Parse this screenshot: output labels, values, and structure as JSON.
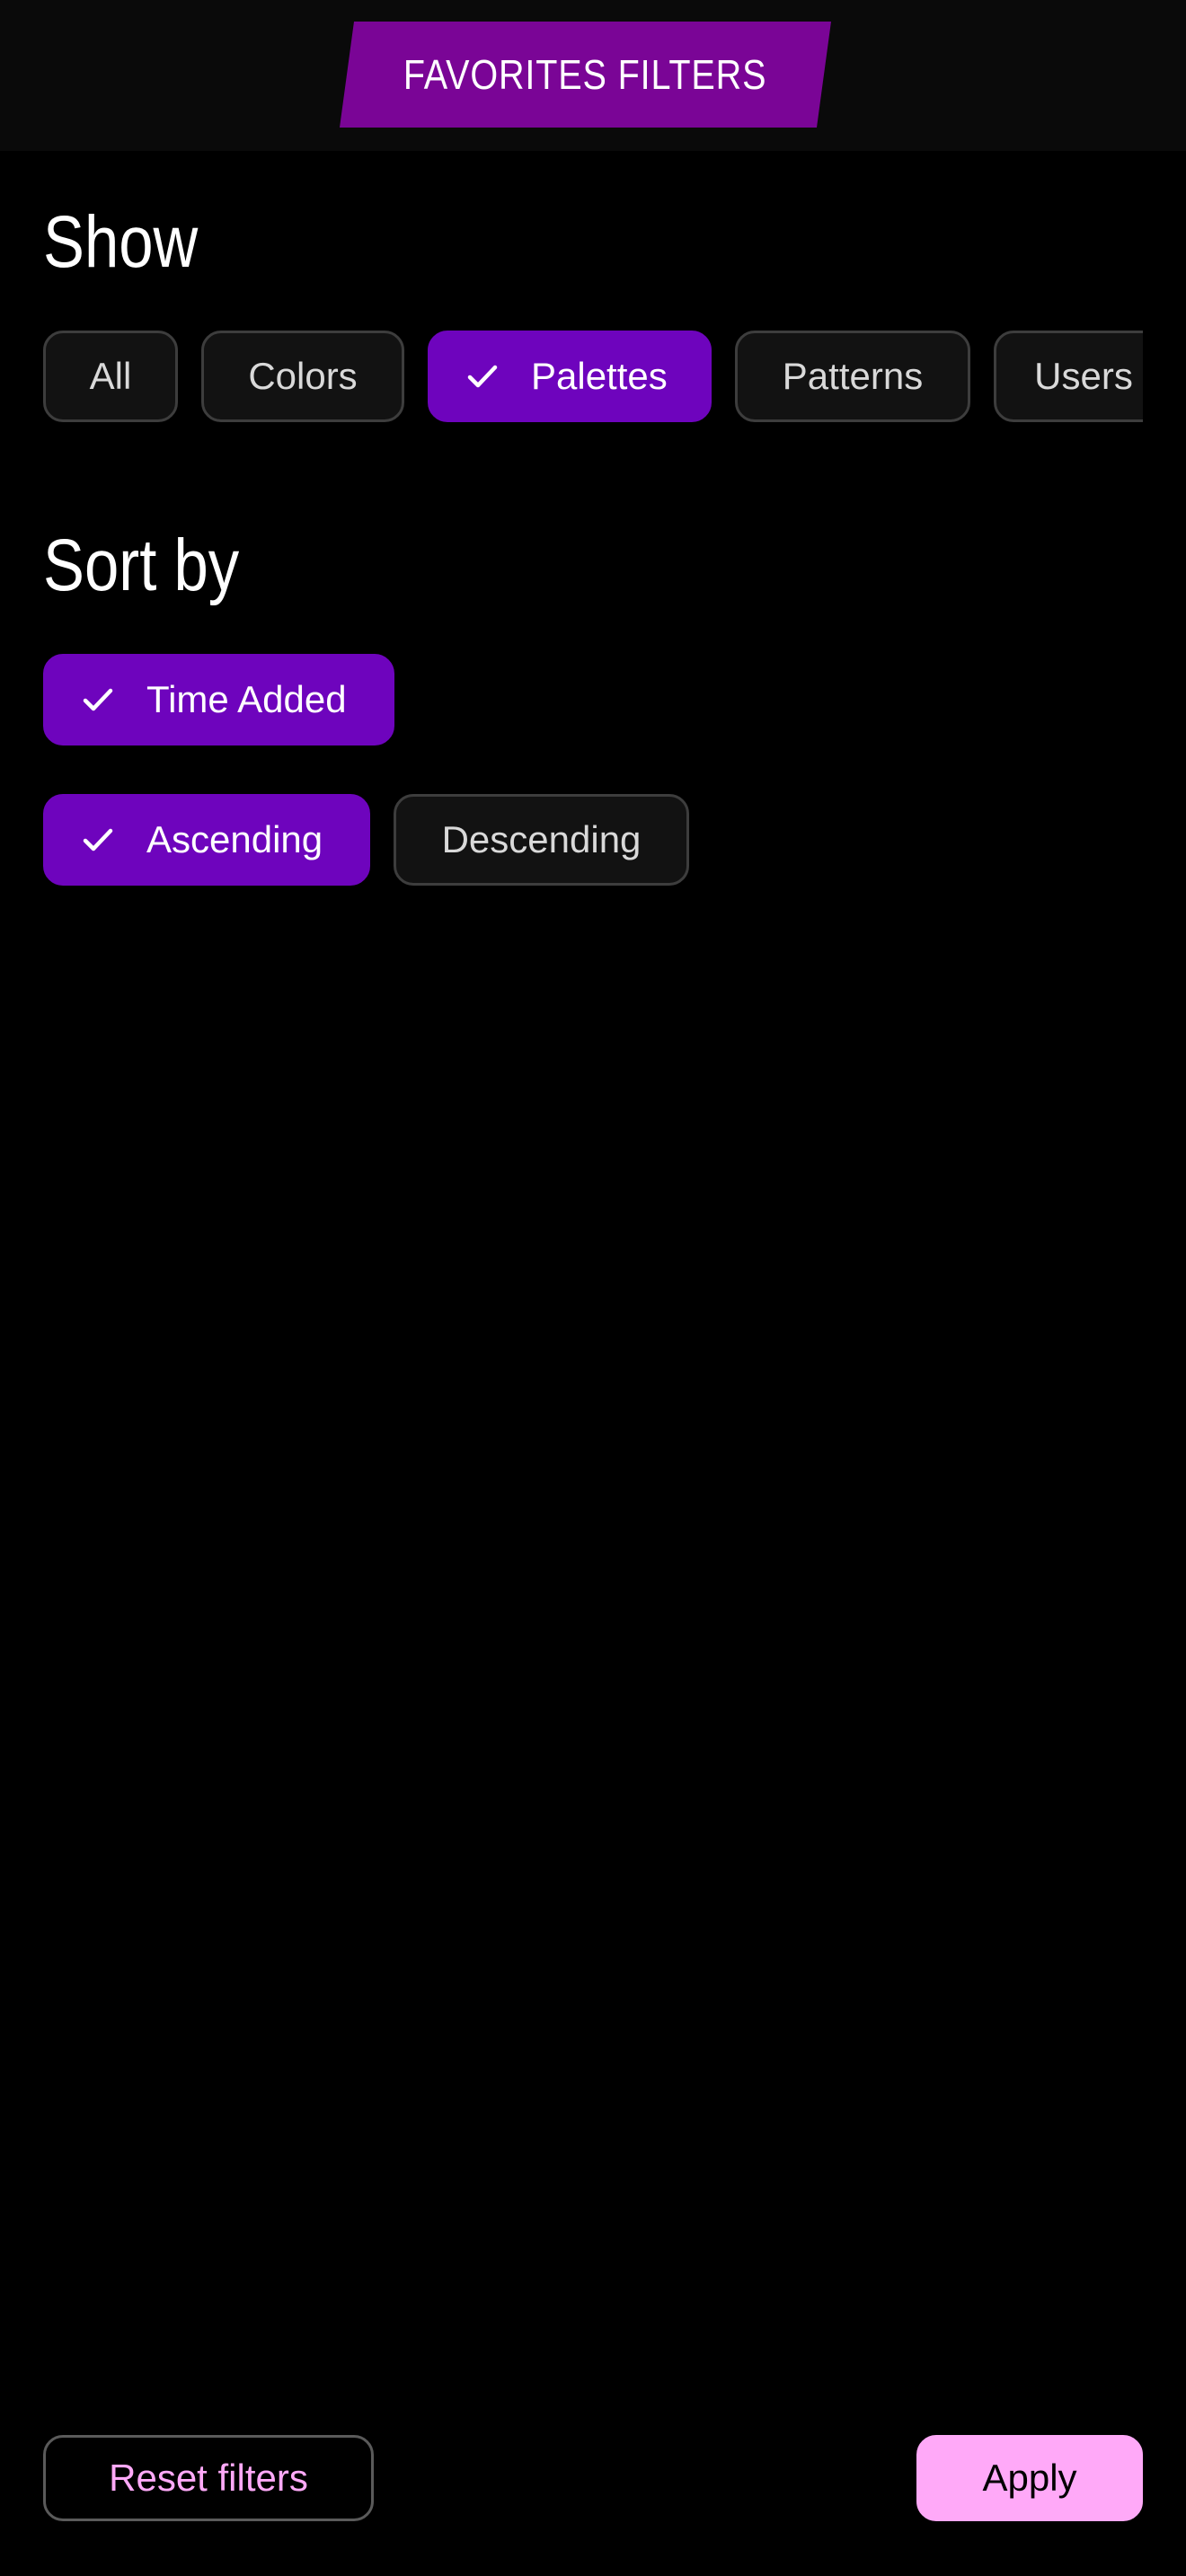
{
  "header": {
    "title": "FAVORITES FILTERS"
  },
  "show": {
    "title": "Show",
    "chips": [
      {
        "label": "All",
        "selected": false
      },
      {
        "label": "Colors",
        "selected": false
      },
      {
        "label": "Palettes",
        "selected": true
      },
      {
        "label": "Patterns",
        "selected": false
      },
      {
        "label": "Users",
        "selected": false
      }
    ]
  },
  "sort": {
    "title": "Sort by",
    "field_chips": [
      {
        "label": "Time Added",
        "selected": true
      }
    ],
    "order_chips": [
      {
        "label": "Ascending",
        "selected": true
      },
      {
        "label": "Descending",
        "selected": false
      }
    ]
  },
  "footer": {
    "reset_label": "Reset filters",
    "apply_label": "Apply"
  },
  "colors": {
    "background": "#000000",
    "header_background": "#0a0a0a",
    "title_tag": "#7a0596",
    "selected_chip": "#6e04bd",
    "accent_pink": "#ffa9f8"
  },
  "icons": {
    "selected_marker": "check-icon"
  }
}
